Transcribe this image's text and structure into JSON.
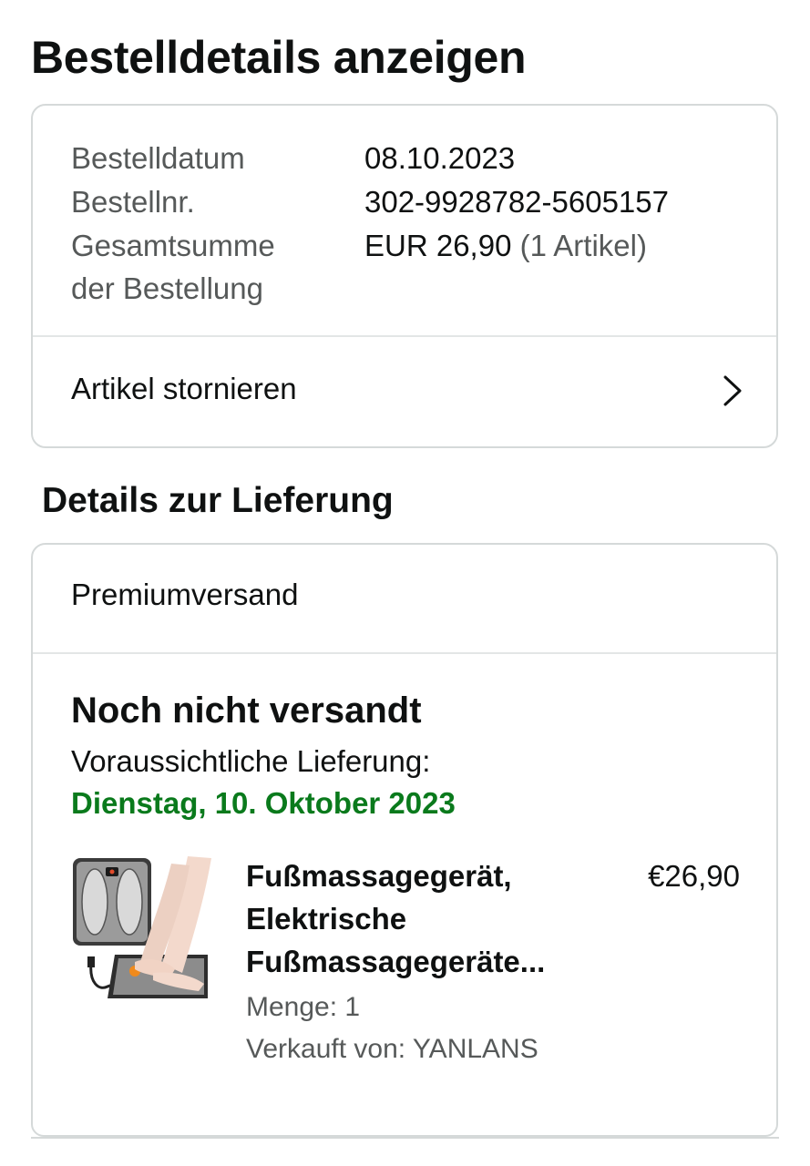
{
  "page": {
    "title": "Bestelldetails anzeigen"
  },
  "order": {
    "date_label": "Bestelldatum",
    "date_value": "08.10.2023",
    "number_label": "Bestellnr.",
    "number_value": "302-9928782-5605157",
    "total_label": "Gesamtsumme der Bestellung",
    "total_value": "EUR 26,90",
    "total_items": "(1 Artikel)",
    "cancel_label": "Artikel stornieren"
  },
  "delivery": {
    "section_title": "Details zur Lieferung",
    "shipping_type": "Premiumversand",
    "status": "Noch nicht versandt",
    "eta_label": "Voraussichtliche Lieferung:",
    "eta_date": "Dienstag, 10. Oktober 2023",
    "product": {
      "title_line1": "Fußmassagegerät,",
      "title_line2": "Elektrische",
      "title_line3": "Fußmassagegeräte...",
      "price": "€26,90",
      "quantity": "Menge: 1",
      "seller": "Verkauft von: YANLANS",
      "image_icon": "foot-massager-product-image"
    }
  },
  "colors": {
    "eta_green": "#0a7a1c",
    "border": "#d5d9d9",
    "muted": "#565959"
  }
}
